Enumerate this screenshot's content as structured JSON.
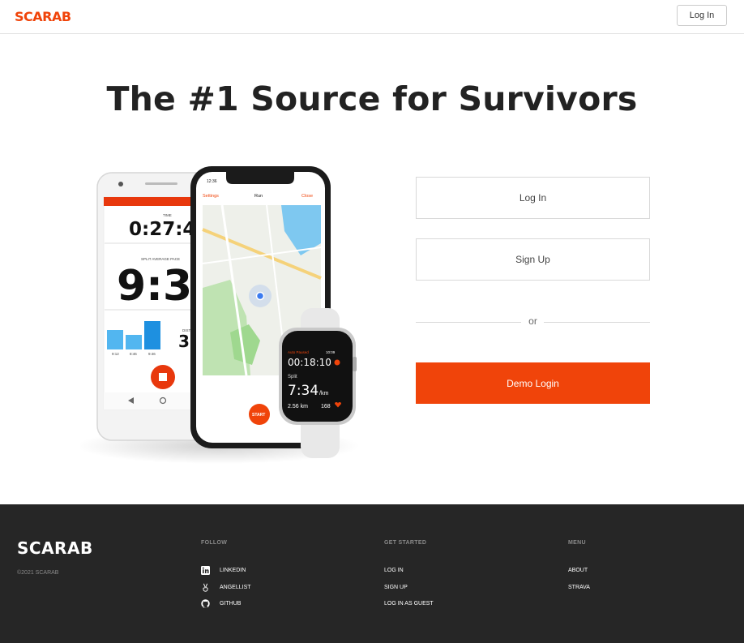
{
  "header": {
    "logo": "SCARAB",
    "login_label": "Log In"
  },
  "hero": {
    "headline": "The #1 Source for Survivors",
    "phone_android": {
      "time_label": "TIME",
      "time_value": "0:27:42",
      "pace_label": "SPLIT AVERAGE PACE",
      "pace_value": "9:30",
      "dist_label": "DIST",
      "dist_value": "3",
      "bar_labels": [
        "9:12",
        "8:46",
        "9:46"
      ]
    },
    "phone_iphone": {
      "clock": "12:36",
      "settings": "Settings",
      "run": "Run",
      "close": "Close",
      "start": "START"
    },
    "watch": {
      "status": "Auto Paused",
      "clock": "10:09",
      "elapsed": "00:18:10",
      "split_label": "Split",
      "pace": "7:34",
      "pace_unit": "/km",
      "distance": "2.56 km",
      "heart": "168"
    }
  },
  "auth": {
    "login_label": "Log In",
    "signup_label": "Sign Up",
    "or_label": "or",
    "demo_label": "Demo Login"
  },
  "footer": {
    "logo": "SCARAB",
    "copyright": "©2021 SCARAB",
    "follow": {
      "heading": "FOLLOW",
      "links": [
        {
          "label": "LINKEDIN",
          "icon": "linkedin-icon"
        },
        {
          "label": "ANGELLIST",
          "icon": "angellist-icon"
        },
        {
          "label": "GITHUB",
          "icon": "github-icon"
        }
      ]
    },
    "get_started": {
      "heading": "GET STARTED",
      "links": [
        "LOG IN",
        "SIGN UP",
        "LOG IN AS GUEST"
      ]
    },
    "menu": {
      "heading": "MENU",
      "links": [
        "ABOUT",
        "STRAVA"
      ]
    }
  },
  "colors": {
    "brand": "#f0440a",
    "footer_bg": "#262626"
  }
}
